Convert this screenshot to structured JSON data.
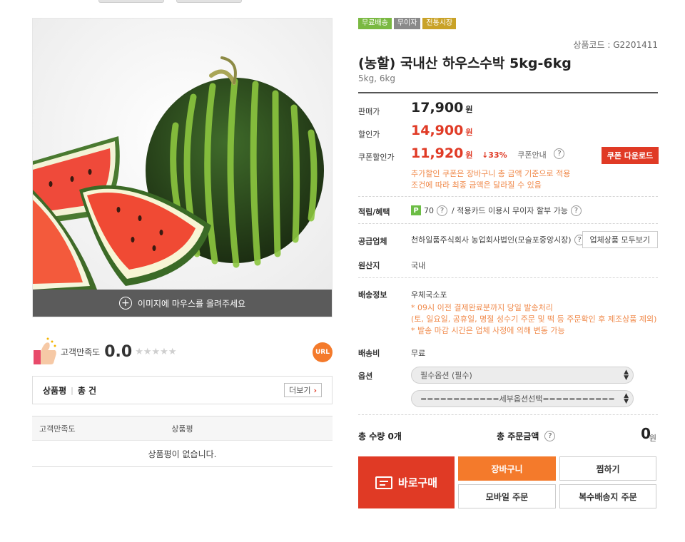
{
  "product": {
    "badges": [
      {
        "label": "무료배송",
        "color": "#7ab942"
      },
      {
        "label": "무이자",
        "color": "#8a8a8a"
      },
      {
        "label": "전통시장",
        "color": "#c9a227"
      }
    ],
    "code": "상품코드 : G2201411",
    "title": "(농할) 국내산 하우스수박 5kg-6kg",
    "subtitle": "5kg, 6kg",
    "image_overlay_text": "이미지에 마우스를 올려주세요"
  },
  "pricing": {
    "sale_label": "판매가",
    "sale_price": "17,900",
    "discount_label": "할인가",
    "discount_price": "14,900",
    "coupon_label": "쿠폰할인가",
    "coupon_price": "11,920",
    "currency": "원",
    "discount_rate": "↓33%",
    "coupon_guide": "쿠폰안내",
    "coupon_button": "쿠폰 다운로드",
    "coupon_note_1": "추가할인 쿠폰은 장바구니 총 금액 기준으로 적용",
    "coupon_note_2": "조건에 따라 최종 금액은 달라질 수 있음"
  },
  "benefits": {
    "label": "적립/혜택",
    "points_icon": "P",
    "points": "70",
    "card_info": "/ 적용카드 이용시 무이자 할부 가능"
  },
  "supplier": {
    "label": "공급업체",
    "name": "천하일품주식회사 농업회사법인(모슬포중앙시장)",
    "all_products_button": "업체상품 모두보기"
  },
  "origin": {
    "label": "원산지",
    "value": "국내"
  },
  "shipping": {
    "label": "배송정보",
    "method": "우체국소포",
    "note_1": "* 09시 이전 결제완료분까지 당일 발송처리",
    "note_2": "(토, 일요일, 공휴일, 명절 성수기 주문 및 떡 등 주문확인 후 제조상품 제외)",
    "note_3": "* 발송 마감 시간은 업체 사정에 의해 변동 가능",
    "fee_label": "배송비",
    "fee_value": "무료"
  },
  "options": {
    "label": "옵션",
    "required_select": "필수옵션 (필수)",
    "detail_select": "============세부옵션선택==========="
  },
  "totals": {
    "quantity_label": "총 수량 0개",
    "amount_label": "총 주문금액",
    "amount": "0",
    "currency": "원"
  },
  "actions": {
    "buy_now": "바로구매",
    "cart": "장바구니",
    "wishlist": "찜하기",
    "mobile_order": "모바일 주문",
    "multi_shipping": "복수배송지 주문"
  },
  "reviews": {
    "satisfaction_label": "고객만족도",
    "satisfaction_value": "0.0",
    "stars_filled": 0,
    "stars_total": 5,
    "url_badge": "URL",
    "title": "상품평",
    "count": "총 건",
    "more_button": "더보기",
    "column_satisfaction": "고객만족도",
    "column_review": "상품평",
    "empty_message": "상품평이 없습니다."
  },
  "help_glyph": "?"
}
